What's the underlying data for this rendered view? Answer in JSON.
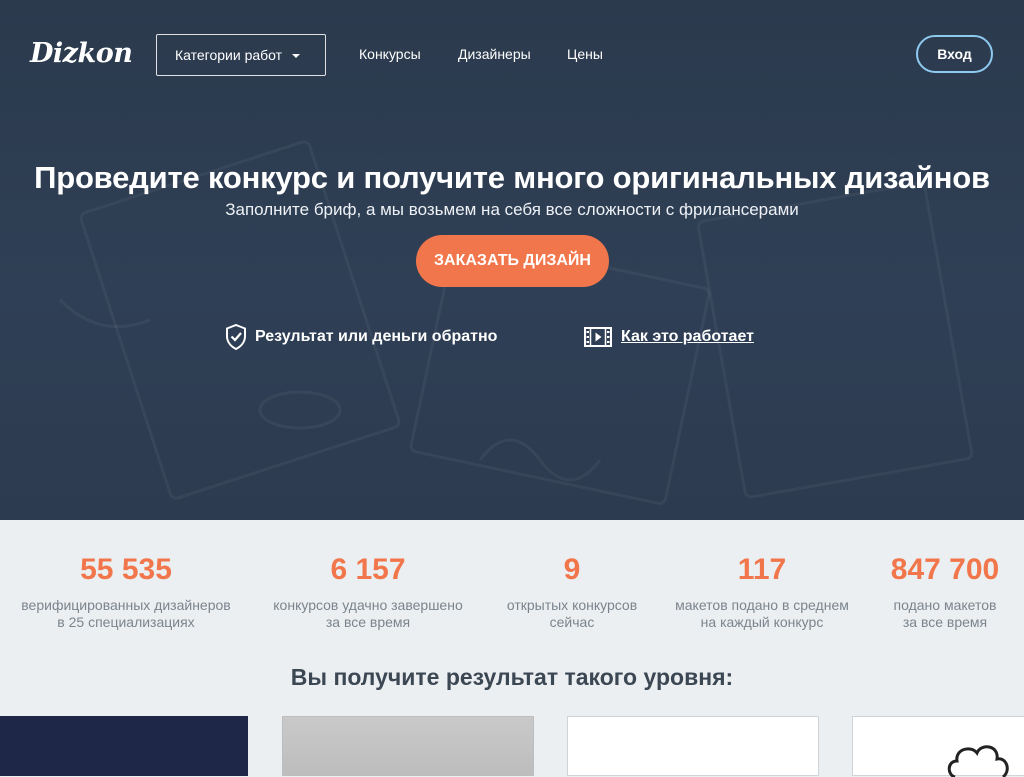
{
  "header": {
    "logo": "Dizkon",
    "categories_label": "Категории работ",
    "nav": [
      "Конкурсы",
      "Дизайнеры",
      "Цены"
    ],
    "login_label": "Вход"
  },
  "hero": {
    "title": "Проведите конкурс и получите много оригинальных дизайнов",
    "subtitle": "Заполните бриф, а мы возьмем на себя все сложности с фрилансерами",
    "cta_label": "ЗАКАЗАТЬ ДИЗАЙН",
    "guarantee_label": "Результат или деньги обратно",
    "how_label": "Как это работает"
  },
  "stats": [
    {
      "value": "55 535",
      "line1": "верифицированных дизайнеров",
      "line2": "в 25 специализациях"
    },
    {
      "value": "6 157",
      "line1": "конкурсов удачно завершено",
      "line2": "за все время"
    },
    {
      "value": "9",
      "line1": "открытых конкурсов",
      "line2": "сейчас"
    },
    {
      "value": "117",
      "line1": "макетов подано в среднем",
      "line2": "на каждый конкурс"
    },
    {
      "value": "847 700",
      "line1": "подано макетов",
      "line2": "за все время"
    }
  ],
  "results": {
    "title": "Вы получите результат такого уровня:"
  },
  "colors": {
    "accent": "#f2764b",
    "hero_bg": "#2f3f55",
    "login_border": "#8ec9ee",
    "stats_bg": "#eceff1"
  },
  "icons": {
    "category_caret": "caret-down-icon",
    "guarantee": "shield-check-icon",
    "how": "film-play-icon"
  }
}
